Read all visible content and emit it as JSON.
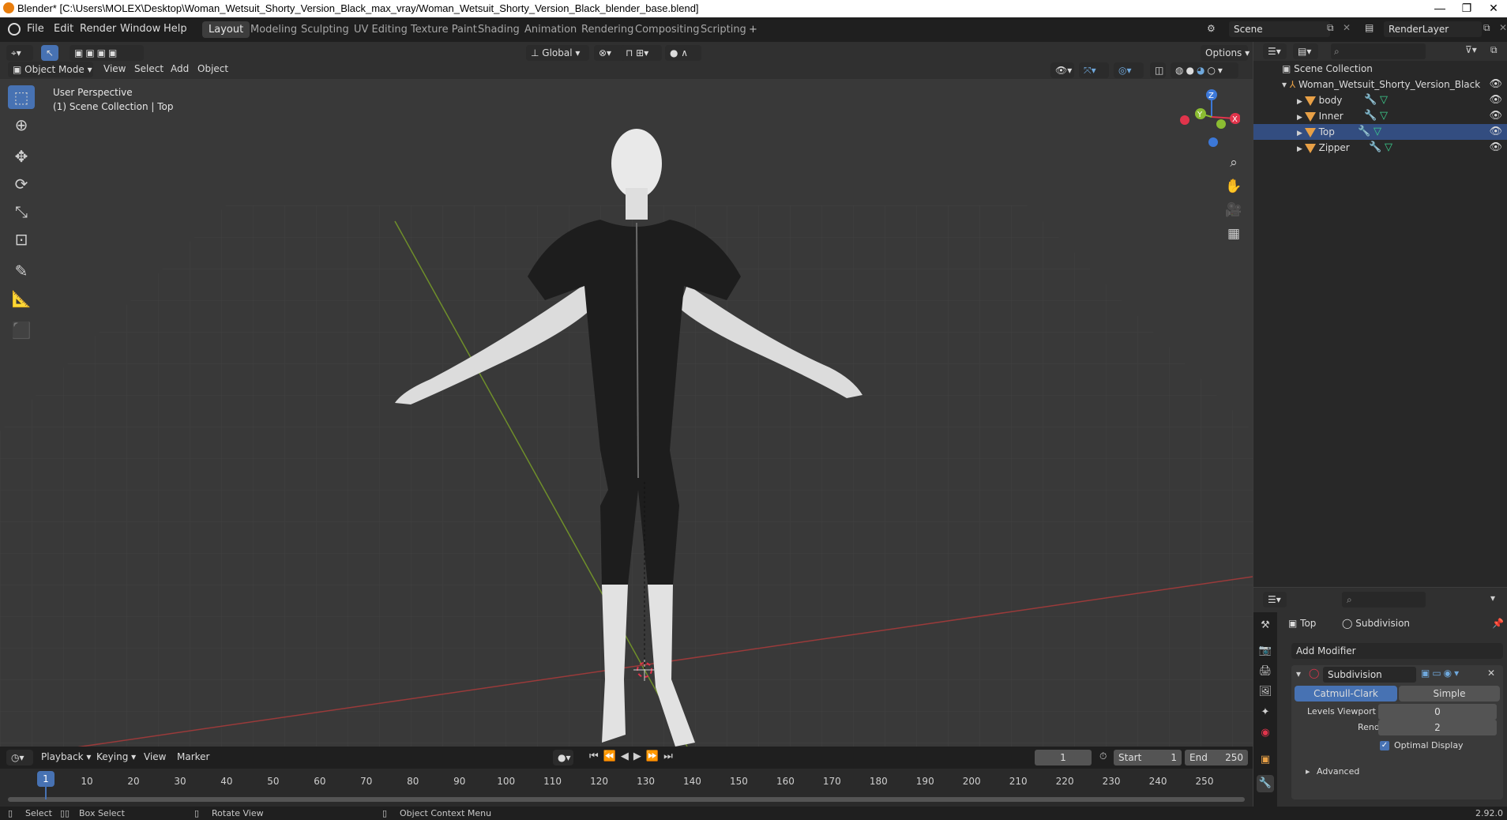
{
  "window": {
    "title": "Blender* [C:\\Users\\MOLEX\\Desktop\\Woman_Wetsuit_Shorty_Version_Black_max_vray/Woman_Wetsuit_Shorty_Version_Black_blender_base.blend]",
    "min": "—",
    "max": "❐",
    "close": "✕"
  },
  "menu": {
    "file": "File",
    "edit": "Edit",
    "render": "Render",
    "window": "Window",
    "help": "Help"
  },
  "workspaces": [
    "Layout",
    "Modeling",
    "Sculpting",
    "UV Editing",
    "Texture Paint",
    "Shading",
    "Animation",
    "Rendering",
    "Compositing",
    "Scripting"
  ],
  "add_workspace": "+",
  "scene": {
    "name": "Scene",
    "render_layer": "RenderLayer"
  },
  "viewport_header": {
    "transform_orientation": "Global",
    "options": "Options",
    "mode": "Object Mode",
    "view": "View",
    "select": "Select",
    "add": "Add",
    "object": "Object"
  },
  "viewport": {
    "perspective": "User Perspective",
    "collection": "(1) Scene Collection | Top",
    "gizmo": {
      "x": "X",
      "y": "Y",
      "z": "Z"
    }
  },
  "outliner": {
    "root": "Scene Collection",
    "collection": "Woman_Wetsuit_Shorty_Version_Black",
    "objects": [
      "body",
      "Inner",
      "Top",
      "Zipper"
    ]
  },
  "properties": {
    "object_name": "Top",
    "modifier_context": "Subdivision",
    "add_modifier": "Add Modifier",
    "modifier": {
      "name": "Subdivision",
      "type_a": "Catmull-Clark",
      "type_b": "Simple",
      "levels_viewport_label": "Levels Viewport",
      "levels_viewport": "0",
      "render_label": "Render",
      "render": "2",
      "optimal_display": "Optimal Display",
      "advanced": "Advanced"
    }
  },
  "timeline": {
    "playback": "Playback",
    "keying": "Keying",
    "view": "View",
    "marker": "Marker",
    "current_frame": "1",
    "start_label": "Start",
    "start": "1",
    "end_label": "End",
    "end": "250",
    "ticks": [
      "1",
      "10",
      "20",
      "30",
      "40",
      "50",
      "60",
      "70",
      "80",
      "90",
      "100",
      "110",
      "120",
      "130",
      "140",
      "150",
      "160",
      "170",
      "180",
      "190",
      "200",
      "210",
      "220",
      "230",
      "240",
      "250"
    ]
  },
  "statusbar": {
    "select": "Select",
    "box_select": "Box Select",
    "rotate_view": "Rotate View",
    "context_menu": "Object Context Menu",
    "version": "2.92.0"
  },
  "colors": {
    "accent": "#4772b3",
    "x_axis": "#e0344b",
    "y_axis": "#8bbd32",
    "z_axis": "#3c78d8",
    "object_orange": "#e8a046"
  }
}
